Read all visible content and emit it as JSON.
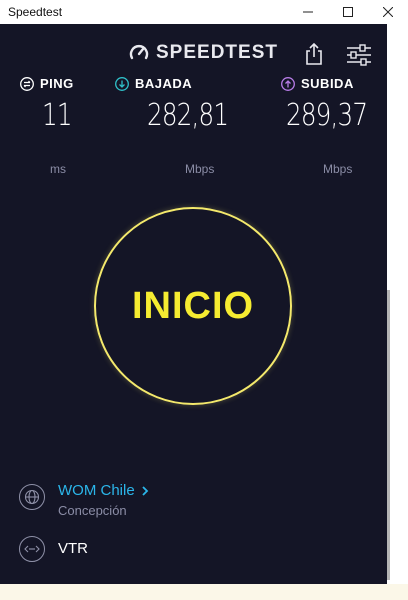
{
  "window": {
    "title": "Speedtest"
  },
  "header": {
    "logo_text": "SPEEDTEST",
    "share_icon": "share-icon",
    "settings_icon": "settings-icon"
  },
  "metrics": {
    "ping": {
      "label": "PING",
      "value": "11",
      "unit": "ms",
      "icon": "ping-icon",
      "color": "#ffffff"
    },
    "download": {
      "label": "BAJADA",
      "value": "282,81",
      "unit": "Mbps",
      "icon": "download-icon",
      "color": "#2fc0c9"
    },
    "upload": {
      "label": "SUBIDA",
      "value": "289,37",
      "unit": "Mbps",
      "icon": "upload-icon",
      "color": "#b77ce6"
    }
  },
  "go_button": {
    "label": "INICIO",
    "color": "#f6ec31"
  },
  "isp": {
    "name": "WOM Chile",
    "location": "Concepción",
    "icon": "globe-icon",
    "color": "#2bb6ea"
  },
  "server": {
    "name": "VTR",
    "icon": "server-icon"
  },
  "colors": {
    "background": "#141526",
    "accent": "#f6ec31",
    "muted": "#8b8da6"
  }
}
